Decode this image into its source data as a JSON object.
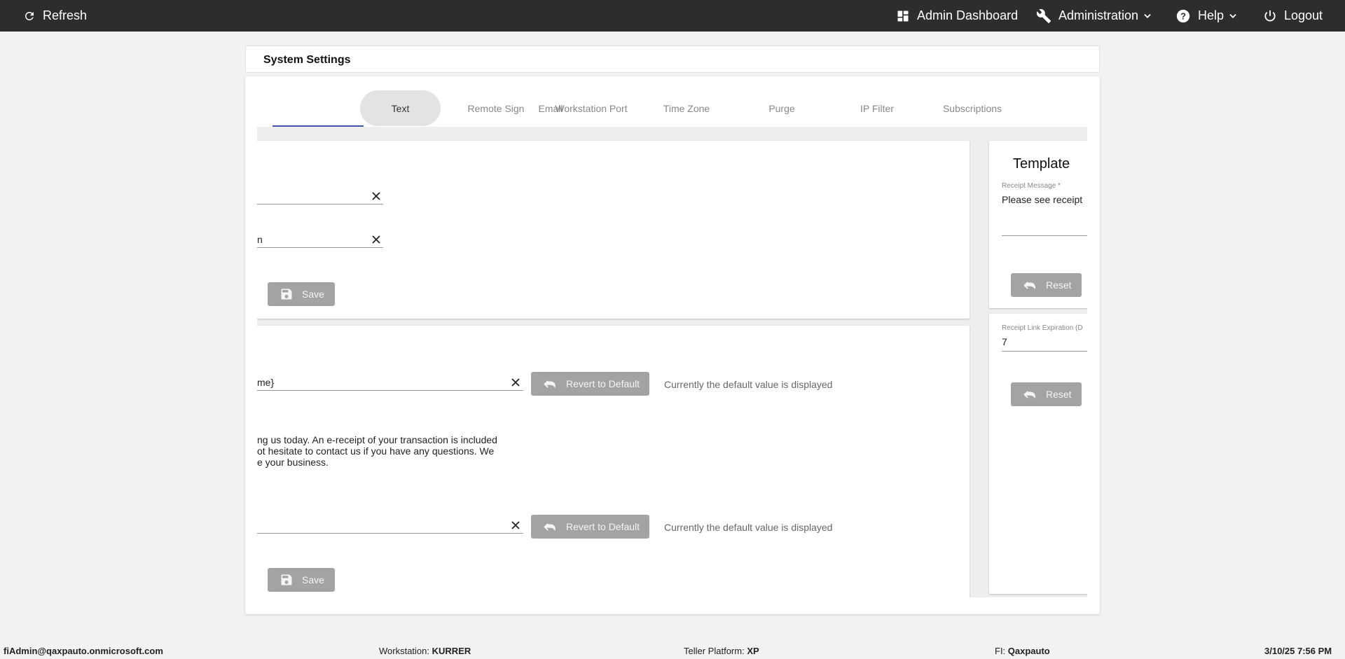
{
  "topbar": {
    "refresh_label": "Refresh",
    "admin_dashboard_label": "Admin Dashboard",
    "administration_label": "Administration",
    "help_label": "Help",
    "logout_label": "Logout"
  },
  "page": {
    "title": "System Settings"
  },
  "tabs": [
    {
      "label": "Email"
    },
    {
      "label": "Text"
    },
    {
      "label": "Remote Sign"
    },
    {
      "label": "Workstation Port"
    },
    {
      "label": "Time Zone"
    },
    {
      "label": "Purge"
    },
    {
      "label": "IP Filter"
    },
    {
      "label": "Subscriptions"
    }
  ],
  "active_tab": "Email",
  "sender_panel": {
    "field1_value": "",
    "field2_value": "n",
    "save_label": "Save"
  },
  "content_panel": {
    "subject_value": "me}",
    "subject_revert_label": "Revert to Default",
    "subject_note": "Currently the default value is displayed",
    "body_line1": "ng us today. An e-receipt of your transaction is included",
    "body_line2": "ot hesitate to contact us if you have any questions. We",
    "body_line3": "e your business.",
    "footer_value": "",
    "footer_revert_label": "Revert to Default",
    "footer_note": "Currently the default value is displayed",
    "save_label": "Save"
  },
  "template_panel": {
    "title": "Template",
    "receipt_message_label": "Receipt Message *",
    "receipt_message_value": "Please see receipt",
    "reset_label": "Reset"
  },
  "expiration_panel": {
    "label": "Receipt Link Expiration (D",
    "value": "7",
    "reset_label": "Reset"
  },
  "footer": {
    "user": "fiAdmin@qaxpauto.onmicrosoft.com",
    "workstation_label": "Workstation:",
    "workstation_value": "KURRER",
    "teller_label": "Teller Platform:",
    "teller_value": "XP",
    "fi_label": "FI:",
    "fi_value": "Qaxpauto",
    "datetime": "3/10/25 7:56 PM"
  },
  "colors": {
    "topbar": "#2d2d2d",
    "tab_indicator": "#3f51b5",
    "button_disabled": "#a3a3a3"
  }
}
